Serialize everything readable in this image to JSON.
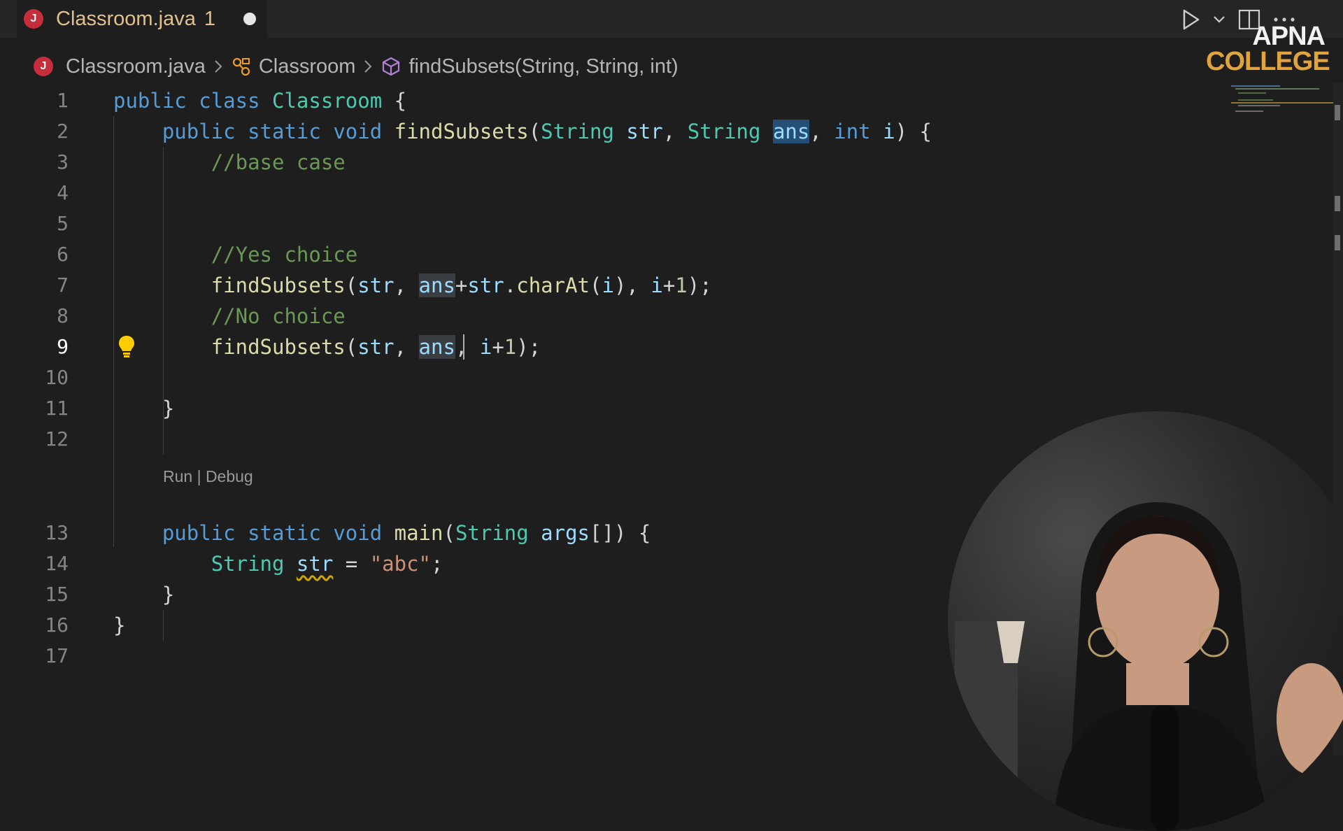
{
  "tab": {
    "icon_letter": "J",
    "title": "Classroom.java",
    "problem_count": "1",
    "unsaved": true
  },
  "breadcrumb": {
    "file": "Classroom.java",
    "class": "Classroom",
    "method": "findSubsets(String, String, int)"
  },
  "editor": {
    "active_line": 9,
    "codelens": "Run | Debug",
    "line_numbers": [
      "1",
      "2",
      "3",
      "4",
      "5",
      "6",
      "7",
      "8",
      "9",
      "10",
      "11",
      "12",
      "13",
      "14",
      "15",
      "16",
      "17"
    ]
  },
  "logo": {
    "line1": "APNA",
    "line2": "COLLEGE"
  },
  "colors": {
    "keyword": "#569cd6",
    "type": "#4ec9b0",
    "function": "#dcdcaa",
    "variable": "#9cdcfe",
    "comment": "#6a9955",
    "string": "#ce9178",
    "number": "#b5cea8",
    "modified_tab": "#e2c08d",
    "java_badge": "#c72e3b",
    "logo_accent": "#e0a33e"
  },
  "icons": {
    "tab": "java-file-icon",
    "run": "play-icon",
    "run_menu": "chevron-down-icon",
    "split": "split-editor-icon",
    "more": "more-actions-icon",
    "class": "class-icon",
    "method": "method-cube-icon",
    "quick_fix": "lightbulb-icon"
  }
}
